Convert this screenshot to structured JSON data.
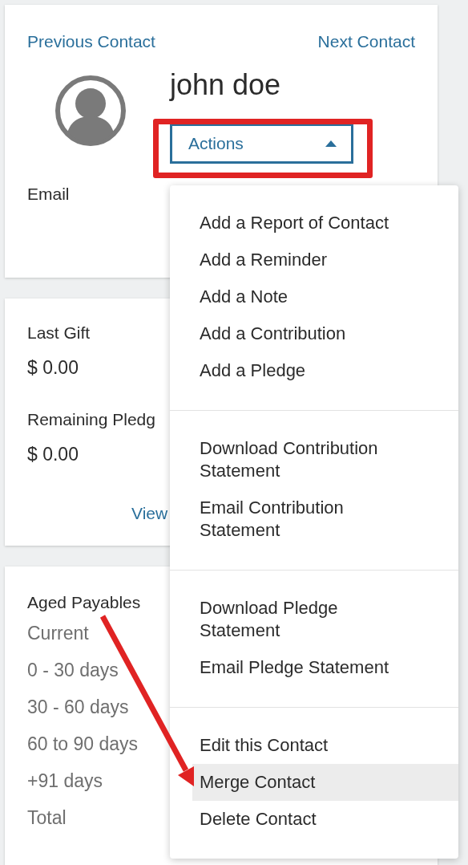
{
  "navigation": {
    "previous": "Previous Contact",
    "next": "Next Contact"
  },
  "contact": {
    "name": "john doe",
    "email_label": "Email"
  },
  "actions_button": {
    "label": "Actions",
    "expanded": true
  },
  "actions_menu": {
    "groups": [
      {
        "items": [
          {
            "label": "Add a Report of Contact",
            "selected": false
          },
          {
            "label": "Add a Reminder",
            "selected": false
          },
          {
            "label": "Add a Note",
            "selected": false
          },
          {
            "label": "Add a Contribution",
            "selected": false
          },
          {
            "label": "Add a Pledge",
            "selected": false
          }
        ]
      },
      {
        "items": [
          {
            "label": "Download Contribution\nStatement",
            "selected": false
          },
          {
            "label": "Email Contribution\nStatement",
            "selected": false
          }
        ]
      },
      {
        "items": [
          {
            "label": "Download Pledge\nStatement",
            "selected": false
          },
          {
            "label": "Email Pledge Statement",
            "selected": false
          }
        ]
      },
      {
        "items": [
          {
            "label": "Edit this Contact",
            "selected": false
          },
          {
            "label": "Merge Contact",
            "selected": true
          },
          {
            "label": "Delete Contact",
            "selected": false
          }
        ]
      }
    ]
  },
  "giving": {
    "fields": [
      {
        "label": "Last Gift",
        "value": "$ 0.00"
      },
      {
        "label": "Remaining Pledg",
        "value": "$ 0.00"
      }
    ],
    "link": "View"
  },
  "aged_payables": {
    "title": "Aged Payables",
    "rows": [
      "Current",
      "0 - 30 days",
      "30 - 60 days",
      "60 to 90 days",
      "+91 days",
      "Total"
    ]
  }
}
